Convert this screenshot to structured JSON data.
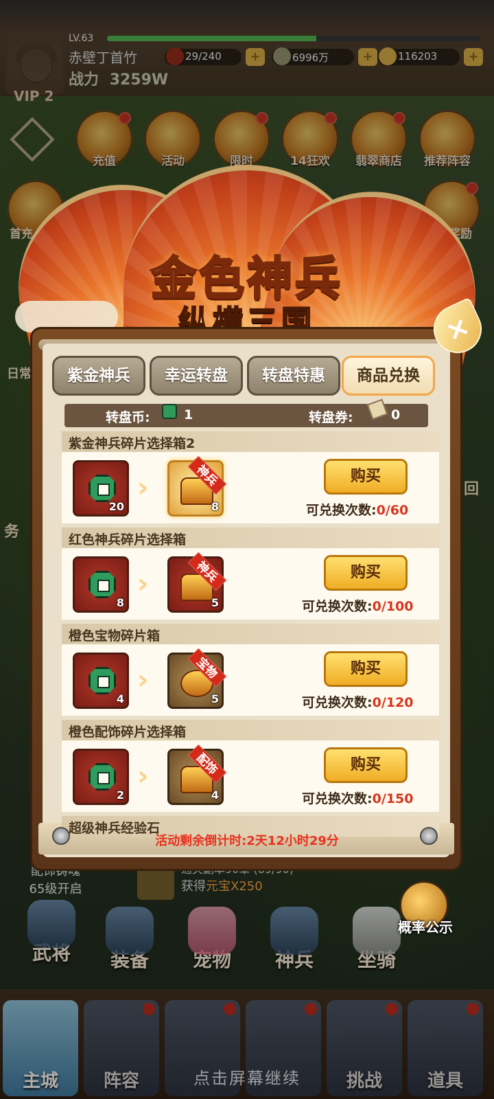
{
  "player": {
    "level": "LV.63",
    "level_progress": 0.56,
    "name": "赤壁丁首竹",
    "power_label": "战力",
    "power_value": "3259W",
    "vip": "VIP 2"
  },
  "resources": [
    {
      "value": "29/240",
      "icon": "meat-icon"
    },
    {
      "value": "6996万",
      "icon": "copper-coin-icon"
    },
    {
      "value": "116203",
      "icon": "gold-ingot-icon"
    }
  ],
  "activities_row1": [
    {
      "label": "充值"
    },
    {
      "label": "活动"
    },
    {
      "label": "限时"
    },
    {
      "label": "14狂欢"
    },
    {
      "label": "翡翠商店"
    },
    {
      "label": "推荐阵容"
    }
  ],
  "side_labels": {
    "left1": "首充",
    "left2": "日常",
    "right1": "奖励",
    "right2": "回",
    "task": "务"
  },
  "modal": {
    "title": "金色神兵",
    "subtitle": "纵横三国",
    "close_icon": "×",
    "tabs": [
      {
        "label": "紫金神兵",
        "active": false
      },
      {
        "label": "幸运转盘",
        "active": false
      },
      {
        "label": "转盘特惠",
        "active": false
      },
      {
        "label": "商品兑换",
        "active": true
      }
    ],
    "currency": {
      "coin_label": "转盘币:",
      "coin_value": "1",
      "ticket_label": "转盘券:",
      "ticket_value": "0"
    },
    "items": [
      {
        "name": "紫金神兵碎片选择箱2",
        "cost": "20",
        "reward_count": "8",
        "tag": "神兵",
        "buy": "购买",
        "limit_label": "可兑换次数:",
        "limit_value": "0/60"
      },
      {
        "name": "红色神兵碎片选择箱",
        "cost": "8",
        "reward_count": "5",
        "tag": "神兵",
        "buy": "购买",
        "limit_label": "可兑换次数:",
        "limit_value": "0/100"
      },
      {
        "name": "橙色宝物碎片箱",
        "cost": "4",
        "reward_count": "5",
        "tag": "宝物",
        "buy": "购买",
        "limit_label": "可兑换次数:",
        "limit_value": "0/120"
      },
      {
        "name": "橙色配饰碎片选择箱",
        "cost": "2",
        "reward_count": "4",
        "tag": "配饰",
        "buy": "购买",
        "limit_label": "可兑换次数:",
        "limit_value": "0/150"
      },
      {
        "name": "超级神兵经验石"
      }
    ],
    "countdown": "活动剩余倒计时:2天12小时29分"
  },
  "quest": {
    "line1": "通关副本90章 (89/90)",
    "line2_prefix": "获得",
    "line2_reward": "元宝X250"
  },
  "unlock_hint": {
    "line1": "配饰铸魂",
    "line2": "65级开启"
  },
  "probability_button": "概率公示",
  "hero_row": [
    {
      "label": "武将"
    },
    {
      "label": "装备"
    },
    {
      "label": "宠物"
    },
    {
      "label": "神兵"
    },
    {
      "label": "坐骑"
    }
  ],
  "bottom_nav": [
    {
      "label": "主城",
      "active": true
    },
    {
      "label": "阵容",
      "active": false
    },
    {
      "label": "",
      "active": false
    },
    {
      "label": "",
      "active": false
    },
    {
      "label": "挑战",
      "active": false
    },
    {
      "label": "道具",
      "active": false
    }
  ],
  "continue_hint": "点击屏幕继续",
  "colors": {
    "accent_red": "#d8351f",
    "button_gold": "#f0ad25",
    "panel_bg": "#eadfc8"
  }
}
